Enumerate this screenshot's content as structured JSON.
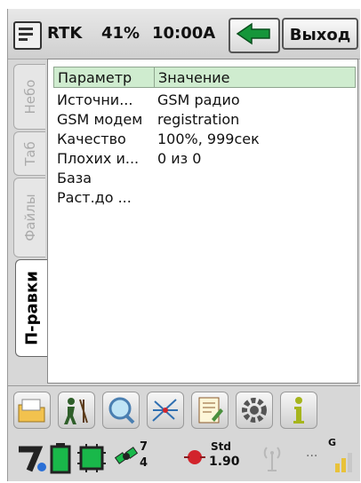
{
  "header": {
    "menu_icon": "start-menu-icon",
    "rtk": "RTK",
    "battery": "41%",
    "time": "10:00A",
    "back_icon": "back-arrow-icon",
    "exit_label": "Выход"
  },
  "tabs": [
    "Небо",
    "Таб",
    "Файлы",
    "П-равки"
  ],
  "active_tab": "П-равки",
  "table": {
    "columns": [
      "Параметр",
      "Значение"
    ],
    "rows": [
      {
        "param": "Источни...",
        "value": "GSM радио"
      },
      {
        "param": "GSM модем",
        "value": "registration"
      },
      {
        "param": "Качество",
        "value": "100%, 999сек"
      },
      {
        "param": "Плохих и...",
        "value": "0 из 0"
      },
      {
        "param": "База",
        "value": ""
      },
      {
        "param": "Раст.до ...",
        "value": ""
      }
    ]
  },
  "toolbar_icons": [
    "folder-icon",
    "survey-icon",
    "search-icon",
    "cogo-icon",
    "notes-icon",
    "settings-icon",
    "info-icon"
  ],
  "status": {
    "satellites_used": "7",
    "satellites_tracked": "4",
    "solution_type": "Std",
    "precision": "1.90",
    "gsm_label": "G",
    "colors": {
      "green": "#19b84a",
      "red": "#d2242c",
      "header_green": "#cfeccf"
    }
  }
}
